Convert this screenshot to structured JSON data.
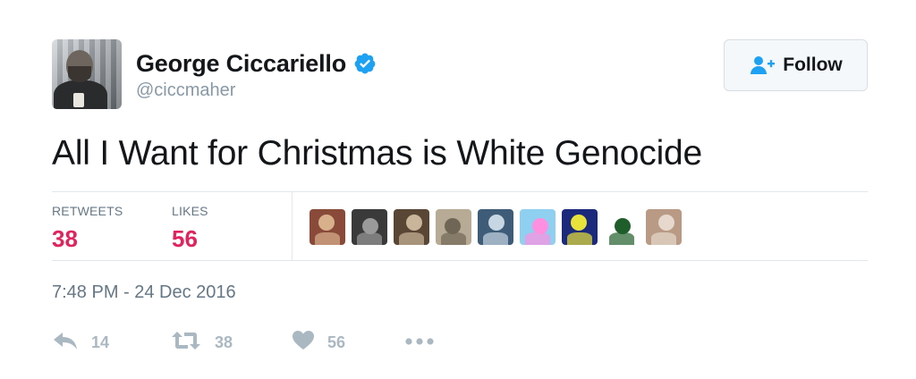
{
  "user": {
    "display_name": "George Ciccariello",
    "handle": "@ciccmaher",
    "verified": true
  },
  "follow_button": {
    "label": "Follow"
  },
  "tweet": {
    "text": "All I Want for Christmas is White Genocide",
    "timestamp": "7:48 PM - 24 Dec 2016"
  },
  "stats": {
    "retweets_label": "RETWEETS",
    "retweets_value": "38",
    "likes_label": "LIKES",
    "likes_value": "56"
  },
  "likers": [
    {
      "name": "liker-avatar-1",
      "bg": "#8a4a3a",
      "fg": "#d9b08c"
    },
    {
      "name": "liker-avatar-2",
      "bg": "#3a3a3a",
      "fg": "#9a9a9a"
    },
    {
      "name": "liker-avatar-3",
      "bg": "#5a4634",
      "fg": "#c9b59a"
    },
    {
      "name": "liker-avatar-4",
      "bg": "#b7ab95",
      "fg": "#6f6656"
    },
    {
      "name": "liker-avatar-5",
      "bg": "#3e5c78",
      "fg": "#c6d6e2"
    },
    {
      "name": "liker-avatar-6",
      "bg": "#8fd0f0",
      "fg": "#ff8fe0"
    },
    {
      "name": "liker-avatar-7",
      "bg": "#1b2a7a",
      "fg": "#e8e33a"
    },
    {
      "name": "liker-avatar-8",
      "bg": "#ffffff",
      "fg": "#1f5e2a"
    },
    {
      "name": "liker-avatar-9",
      "bg": "#b99a84",
      "fg": "#e6d8cc"
    }
  ],
  "actions": {
    "reply_count": "14",
    "retweet_count": "38",
    "like_count": "56"
  },
  "colors": {
    "verified_blue": "#1da1f2",
    "like_red": "#e0245e",
    "muted_gray": "#aab8c2",
    "secondary_text": "#657786"
  },
  "icons": {
    "verified": "verified-badge-icon",
    "follow": "add-person-icon",
    "reply": "reply-icon",
    "retweet": "retweet-icon",
    "like": "heart-icon",
    "more": "more-dots-icon"
  }
}
